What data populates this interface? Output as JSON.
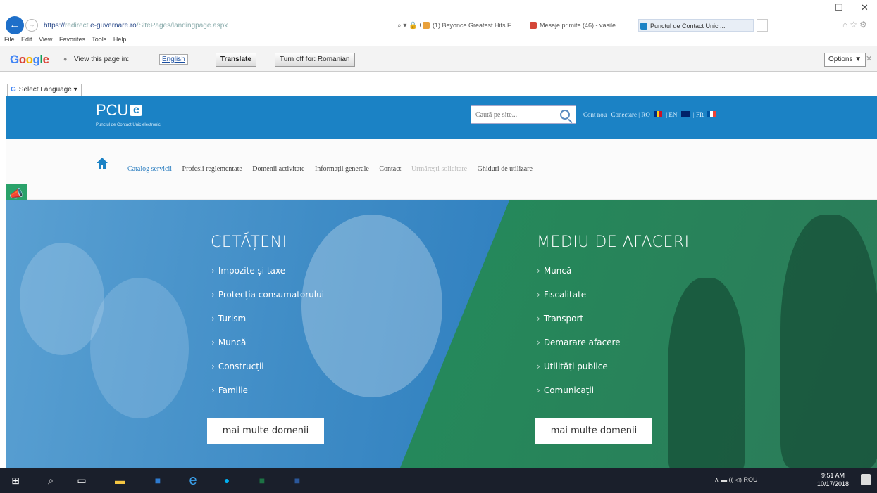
{
  "window": {
    "minimize": "—",
    "restore": "☐",
    "close": "✕"
  },
  "browser": {
    "url_main": "https://",
    "url_dim": "redirect.",
    "url_domain": "e-guvernare.ro",
    "url_path": "/SitePages/landingpage.aspx",
    "addr_tools": "⌕ ▾ 🔒 C",
    "tabs": [
      {
        "label": "(1) Beyonce Greatest Hits F...",
        "color": "#e9a13b"
      },
      {
        "label": "Mesaje primite (46) - vasile...",
        "color": "#d44638"
      },
      {
        "label": "Punctul de Contact Unic ...",
        "color": "#1b82c5"
      }
    ],
    "menu": [
      "File",
      "Edit",
      "View",
      "Favorites",
      "Tools",
      "Help"
    ]
  },
  "gtranslate": {
    "logo": [
      "G",
      "o",
      "o",
      "g",
      "l",
      "e"
    ],
    "prompt": "View this page in:",
    "lang": "English",
    "translate_btn": "Translate",
    "turnoff_btn": "Turn off for: Romanian",
    "options_btn": "Options ▼",
    "select_language": "Select Language",
    "g_letter": "G"
  },
  "site": {
    "logo_text": "PCU",
    "logo_e": "e",
    "logo_sub": "Punctul de Contact Unic electronic",
    "search_placeholder": "Caută pe site...",
    "header_links": "Cont nou  |  Conectare  |  RO",
    "lang_en": "EN",
    "lang_fr": "FR",
    "nav": [
      {
        "label": "Catalog servicii",
        "style": "blue"
      },
      {
        "label": "Profesii reglementate",
        "style": ""
      },
      {
        "label": "Domenii activitate",
        "style": ""
      },
      {
        "label": "Informații generale",
        "style": ""
      },
      {
        "label": "Contact",
        "style": ""
      },
      {
        "label": "Urmărești solicitare",
        "style": "muted"
      },
      {
        "label": "Ghiduri de utilizare",
        "style": ""
      }
    ],
    "citizens_title": "CETĂȚENI",
    "citizens_items": [
      "Impozite și taxe",
      "Protecția consumatorului",
      "Turism",
      "Muncă",
      "Construcții",
      "Familie"
    ],
    "business_title": "MEDIU DE AFACERI",
    "business_items": [
      "Muncă",
      "Fiscalitate",
      "Transport",
      "Demarare afacere",
      "Utilități publice",
      "Comunicații"
    ],
    "more_label": "mai multe domenii"
  },
  "taskbar": {
    "tray": "∧  ▬  ((   ◁)  ROU",
    "time": "9:51 AM",
    "date": "10/17/2018"
  },
  "colors": {
    "brand_blue": "#1b82c5",
    "green": "#2aa26a"
  }
}
